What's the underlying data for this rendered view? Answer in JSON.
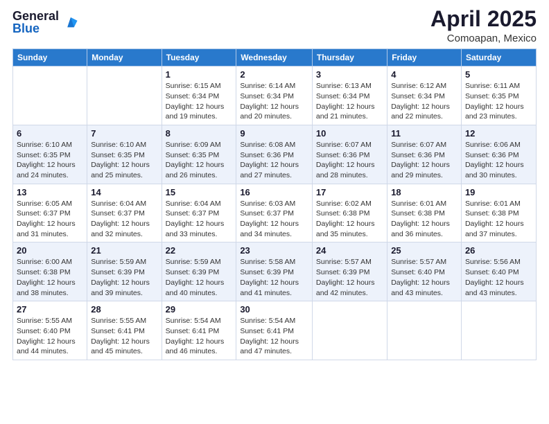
{
  "header": {
    "logo_general": "General",
    "logo_blue": "Blue",
    "title": "April 2025",
    "location": "Comoapan, Mexico"
  },
  "weekdays": [
    "Sunday",
    "Monday",
    "Tuesday",
    "Wednesday",
    "Thursday",
    "Friday",
    "Saturday"
  ],
  "rows": [
    [
      {
        "day": "",
        "info": ""
      },
      {
        "day": "",
        "info": ""
      },
      {
        "day": "1",
        "info": "Sunrise: 6:15 AM\nSunset: 6:34 PM\nDaylight: 12 hours and 19 minutes."
      },
      {
        "day": "2",
        "info": "Sunrise: 6:14 AM\nSunset: 6:34 PM\nDaylight: 12 hours and 20 minutes."
      },
      {
        "day": "3",
        "info": "Sunrise: 6:13 AM\nSunset: 6:34 PM\nDaylight: 12 hours and 21 minutes."
      },
      {
        "day": "4",
        "info": "Sunrise: 6:12 AM\nSunset: 6:34 PM\nDaylight: 12 hours and 22 minutes."
      },
      {
        "day": "5",
        "info": "Sunrise: 6:11 AM\nSunset: 6:35 PM\nDaylight: 12 hours and 23 minutes."
      }
    ],
    [
      {
        "day": "6",
        "info": "Sunrise: 6:10 AM\nSunset: 6:35 PM\nDaylight: 12 hours and 24 minutes."
      },
      {
        "day": "7",
        "info": "Sunrise: 6:10 AM\nSunset: 6:35 PM\nDaylight: 12 hours and 25 minutes."
      },
      {
        "day": "8",
        "info": "Sunrise: 6:09 AM\nSunset: 6:35 PM\nDaylight: 12 hours and 26 minutes."
      },
      {
        "day": "9",
        "info": "Sunrise: 6:08 AM\nSunset: 6:36 PM\nDaylight: 12 hours and 27 minutes."
      },
      {
        "day": "10",
        "info": "Sunrise: 6:07 AM\nSunset: 6:36 PM\nDaylight: 12 hours and 28 minutes."
      },
      {
        "day": "11",
        "info": "Sunrise: 6:07 AM\nSunset: 6:36 PM\nDaylight: 12 hours and 29 minutes."
      },
      {
        "day": "12",
        "info": "Sunrise: 6:06 AM\nSunset: 6:36 PM\nDaylight: 12 hours and 30 minutes."
      }
    ],
    [
      {
        "day": "13",
        "info": "Sunrise: 6:05 AM\nSunset: 6:37 PM\nDaylight: 12 hours and 31 minutes."
      },
      {
        "day": "14",
        "info": "Sunrise: 6:04 AM\nSunset: 6:37 PM\nDaylight: 12 hours and 32 minutes."
      },
      {
        "day": "15",
        "info": "Sunrise: 6:04 AM\nSunset: 6:37 PM\nDaylight: 12 hours and 33 minutes."
      },
      {
        "day": "16",
        "info": "Sunrise: 6:03 AM\nSunset: 6:37 PM\nDaylight: 12 hours and 34 minutes."
      },
      {
        "day": "17",
        "info": "Sunrise: 6:02 AM\nSunset: 6:38 PM\nDaylight: 12 hours and 35 minutes."
      },
      {
        "day": "18",
        "info": "Sunrise: 6:01 AM\nSunset: 6:38 PM\nDaylight: 12 hours and 36 minutes."
      },
      {
        "day": "19",
        "info": "Sunrise: 6:01 AM\nSunset: 6:38 PM\nDaylight: 12 hours and 37 minutes."
      }
    ],
    [
      {
        "day": "20",
        "info": "Sunrise: 6:00 AM\nSunset: 6:38 PM\nDaylight: 12 hours and 38 minutes."
      },
      {
        "day": "21",
        "info": "Sunrise: 5:59 AM\nSunset: 6:39 PM\nDaylight: 12 hours and 39 minutes."
      },
      {
        "day": "22",
        "info": "Sunrise: 5:59 AM\nSunset: 6:39 PM\nDaylight: 12 hours and 40 minutes."
      },
      {
        "day": "23",
        "info": "Sunrise: 5:58 AM\nSunset: 6:39 PM\nDaylight: 12 hours and 41 minutes."
      },
      {
        "day": "24",
        "info": "Sunrise: 5:57 AM\nSunset: 6:39 PM\nDaylight: 12 hours and 42 minutes."
      },
      {
        "day": "25",
        "info": "Sunrise: 5:57 AM\nSunset: 6:40 PM\nDaylight: 12 hours and 43 minutes."
      },
      {
        "day": "26",
        "info": "Sunrise: 5:56 AM\nSunset: 6:40 PM\nDaylight: 12 hours and 43 minutes."
      }
    ],
    [
      {
        "day": "27",
        "info": "Sunrise: 5:55 AM\nSunset: 6:40 PM\nDaylight: 12 hours and 44 minutes."
      },
      {
        "day": "28",
        "info": "Sunrise: 5:55 AM\nSunset: 6:41 PM\nDaylight: 12 hours and 45 minutes."
      },
      {
        "day": "29",
        "info": "Sunrise: 5:54 AM\nSunset: 6:41 PM\nDaylight: 12 hours and 46 minutes."
      },
      {
        "day": "30",
        "info": "Sunrise: 5:54 AM\nSunset: 6:41 PM\nDaylight: 12 hours and 47 minutes."
      },
      {
        "day": "",
        "info": ""
      },
      {
        "day": "",
        "info": ""
      },
      {
        "day": "",
        "info": ""
      }
    ]
  ]
}
